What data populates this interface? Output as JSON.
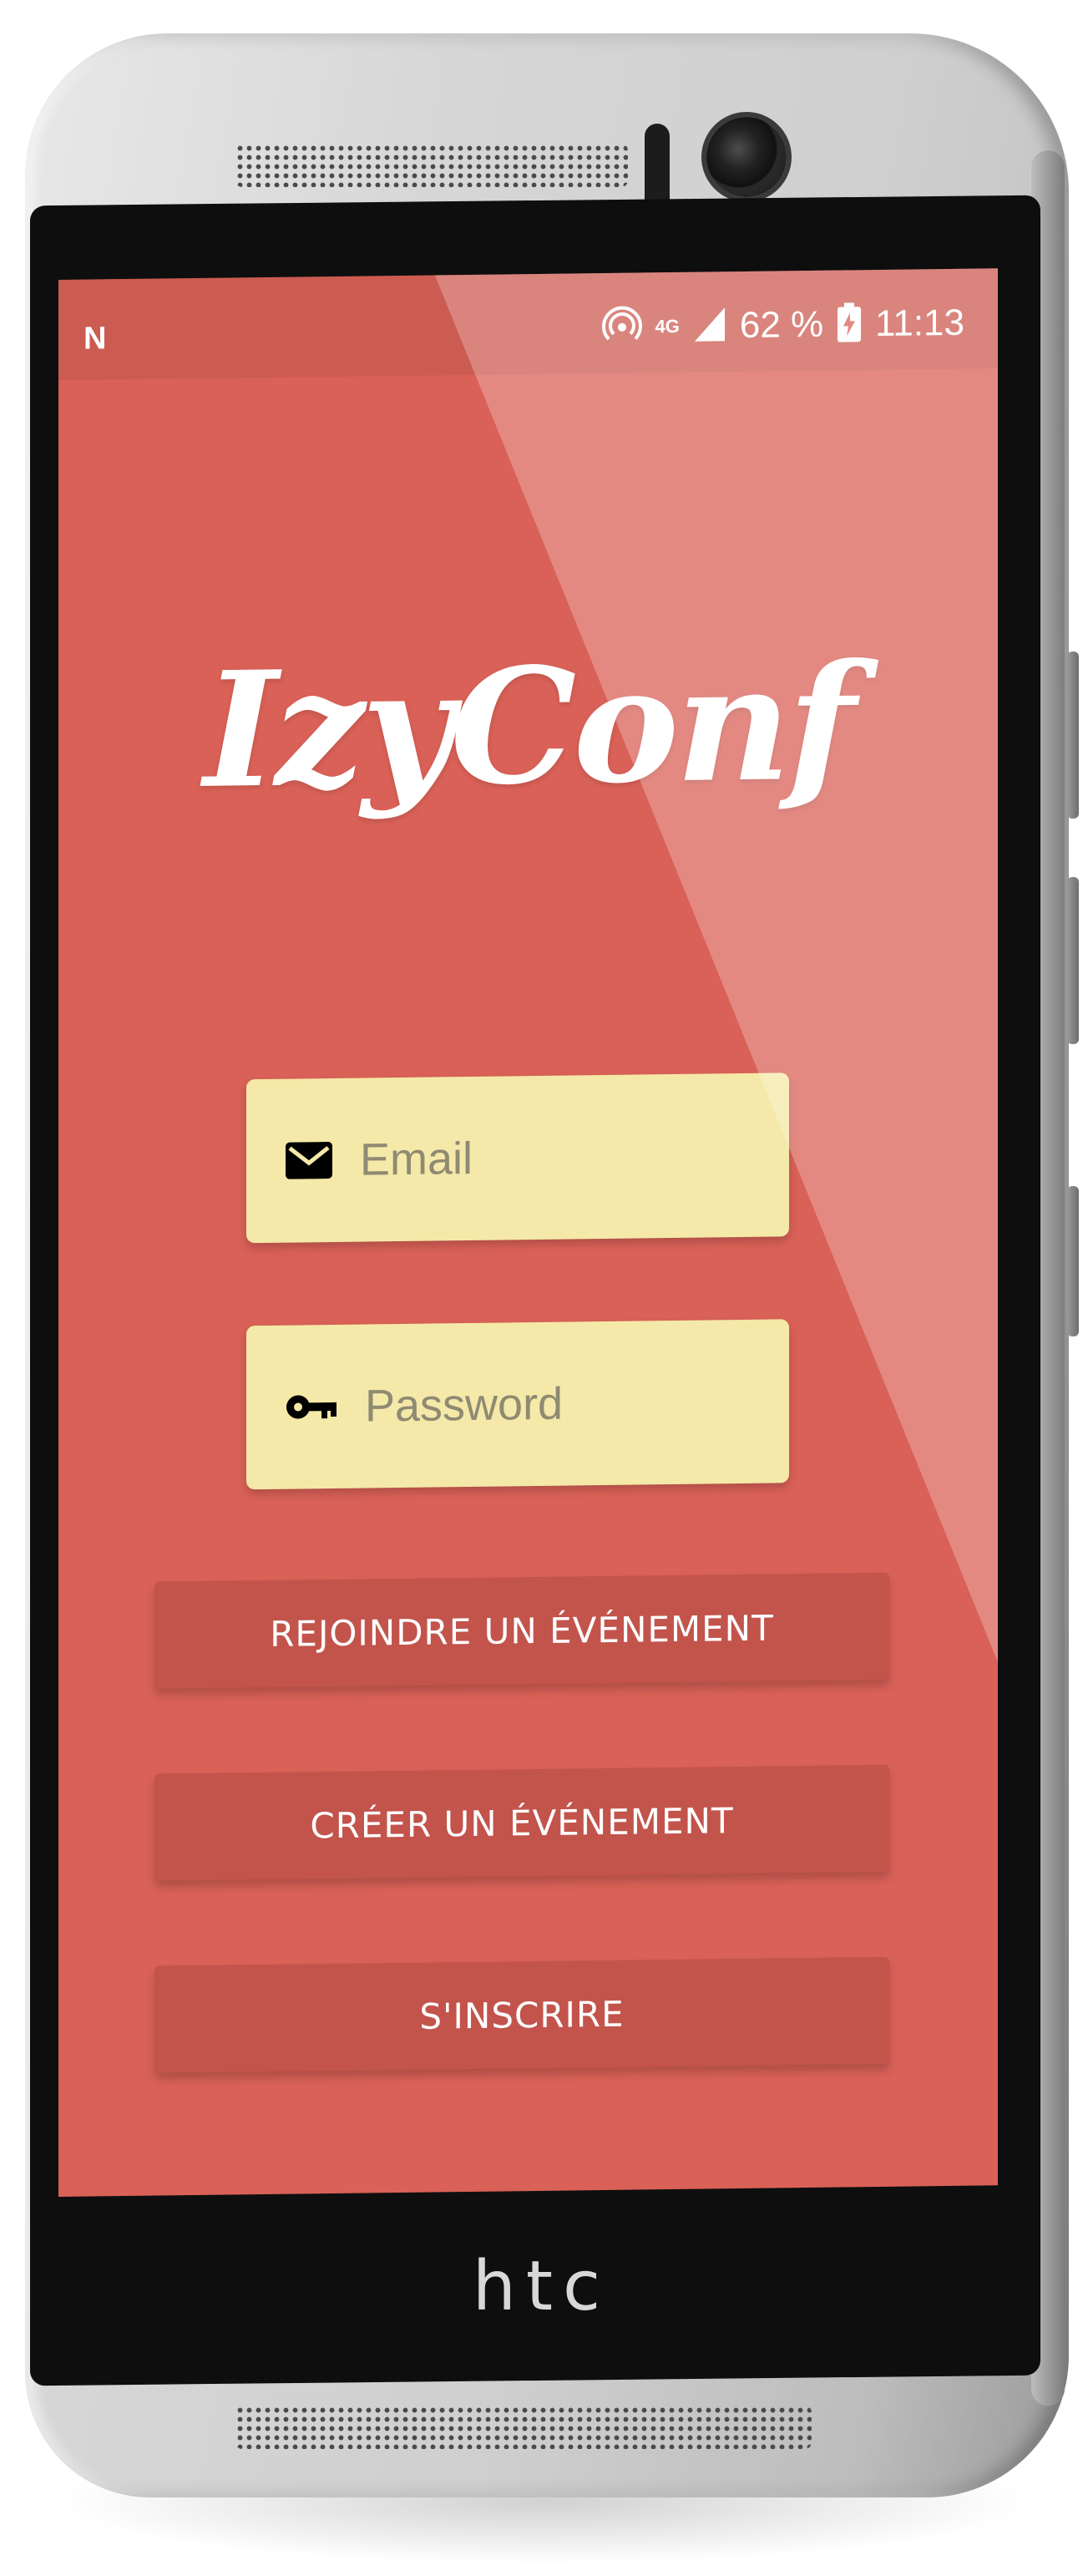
{
  "device": {
    "brand": "htc"
  },
  "status_bar": {
    "left_icon": "notification-n-icon",
    "network": "4G",
    "battery_percent": "62 %",
    "time": "11:13"
  },
  "app": {
    "logo_text": "IzyConf"
  },
  "form": {
    "email": {
      "placeholder": "Email",
      "value": "",
      "icon": "envelope-icon"
    },
    "password": {
      "placeholder": "Password",
      "value": "",
      "icon": "key-icon"
    }
  },
  "buttons": {
    "join_event": "REJOINDRE UN ÉVÉNEMENT",
    "create_event": "CRÉER UN ÉVÉNEMENT",
    "sign_up": "S'INSCRIRE"
  },
  "colors": {
    "screen_background": "#d96157",
    "input_background": "#f4e9a8",
    "button_background": "#c2544c",
    "text_on_red": "#ffffff"
  }
}
